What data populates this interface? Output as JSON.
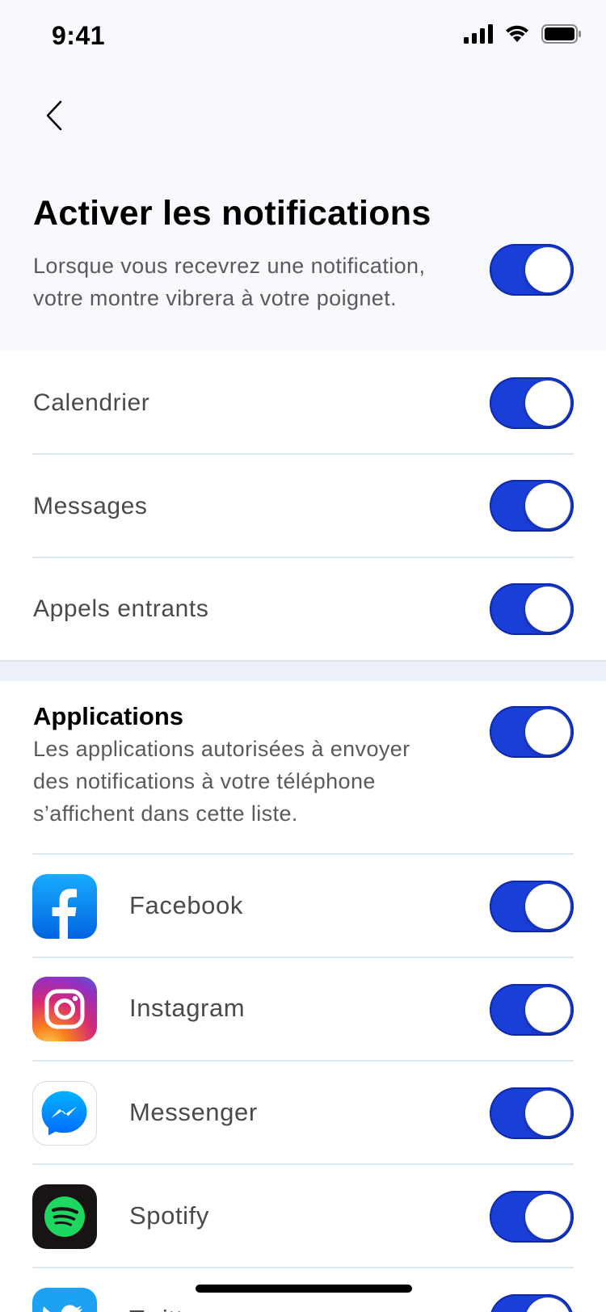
{
  "status_bar": {
    "time": "9:41"
  },
  "header": {
    "title": "Activer les notifications",
    "description": "Lorsque vous recevrez une notification, votre montre vibrera à votre poignet.",
    "enabled": true
  },
  "general": [
    {
      "label": "Calendrier",
      "enabled": true
    },
    {
      "label": "Messages",
      "enabled": true
    },
    {
      "label": "Appels entrants",
      "enabled": true
    }
  ],
  "applications": {
    "title": "Applications",
    "description": "Les applications autorisées à envoyer des notifications à votre téléphone s’affichent dans cette liste.",
    "enabled": true,
    "items": [
      {
        "label": "Facebook",
        "icon": "facebook-icon",
        "enabled": true
      },
      {
        "label": "Instagram",
        "icon": "instagram-icon",
        "enabled": true
      },
      {
        "label": "Messenger",
        "icon": "messenger-icon",
        "enabled": true
      },
      {
        "label": "Spotify",
        "icon": "spotify-icon",
        "enabled": true
      },
      {
        "label": "Twitter",
        "icon": "twitter-icon",
        "enabled": true
      }
    ]
  },
  "colors": {
    "toggle_on": "#1a3ed8",
    "header_bg": "#f7f9fc",
    "facebook": "#1877f2",
    "messenger": "#0a7cff",
    "spotify": "#1ed760",
    "twitter": "#1da1f2"
  }
}
